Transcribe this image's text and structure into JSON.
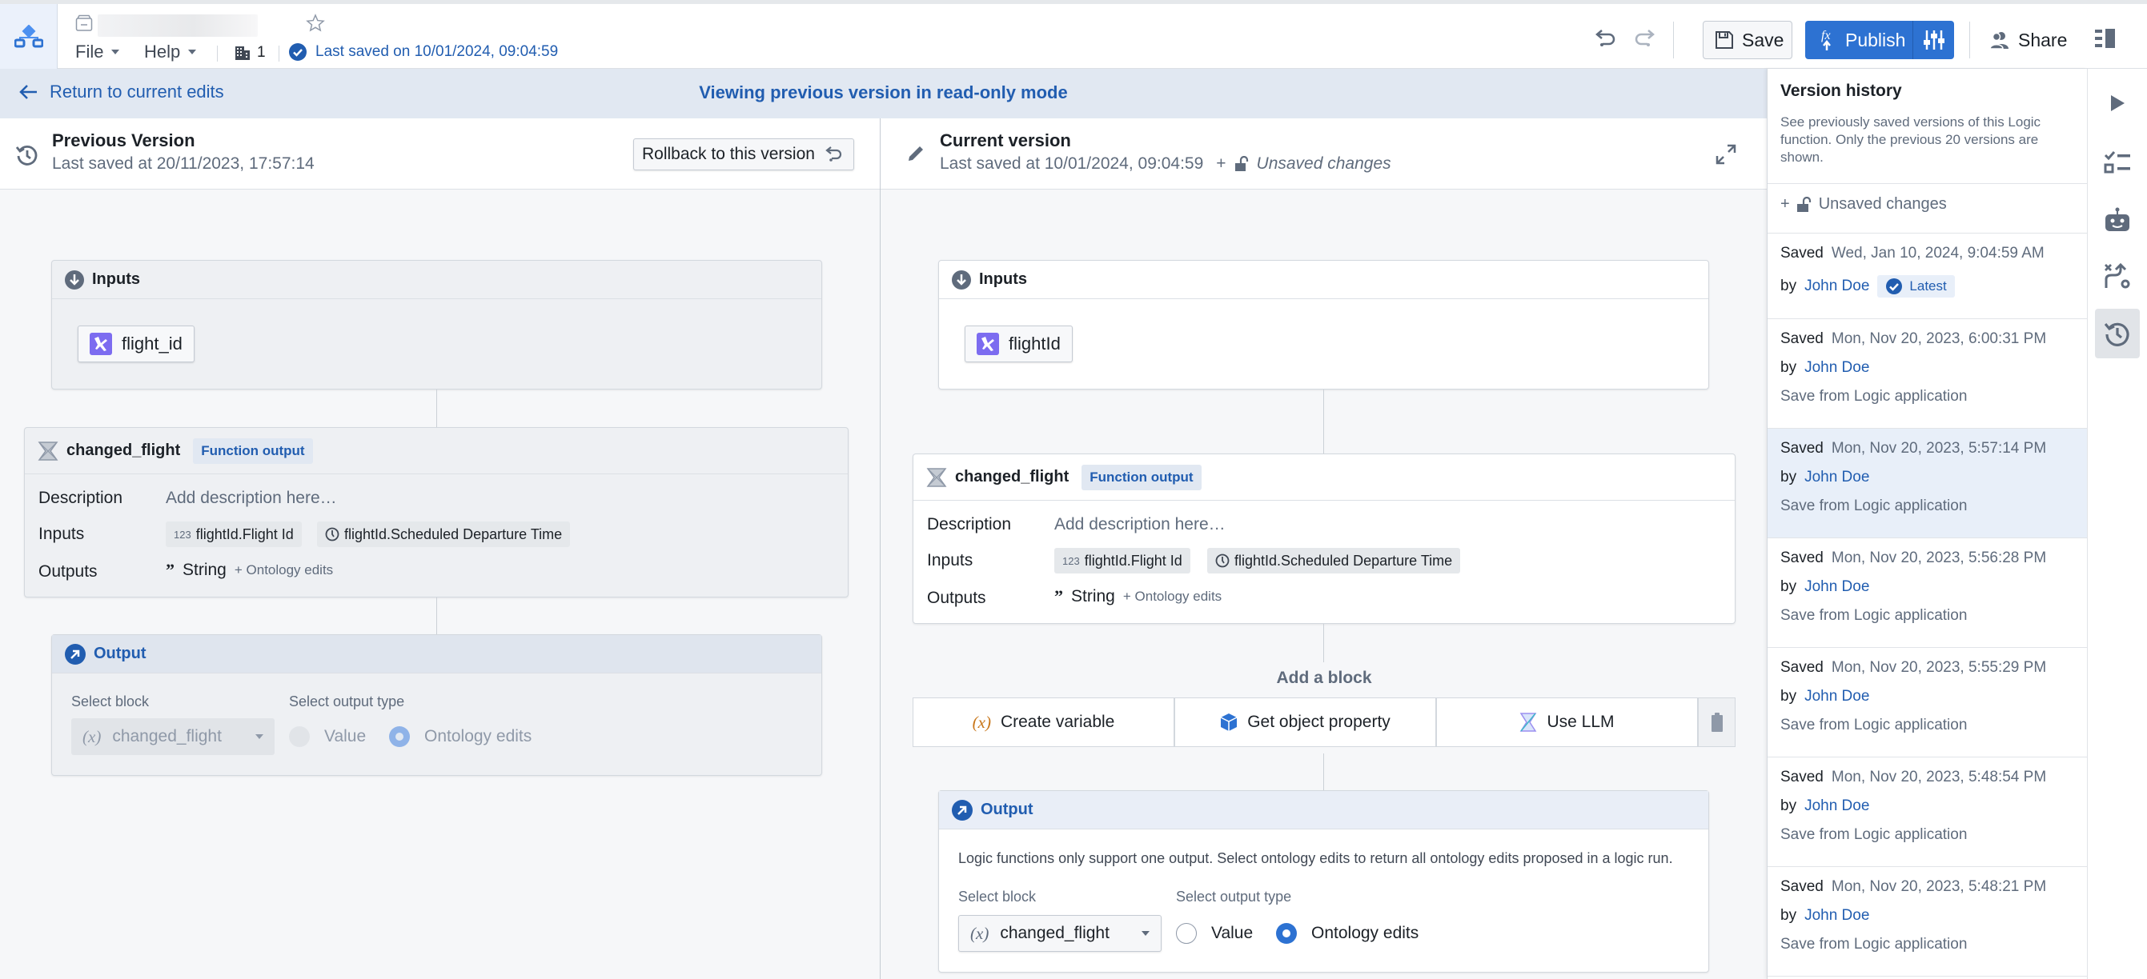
{
  "topbar": {
    "menus": [
      {
        "label": "File"
      },
      {
        "label": "Help"
      }
    ],
    "project_count": "1",
    "last_saved": "Last saved on 10/01/2024, 09:04:59",
    "save_label": "Save",
    "publish_label": "Publish",
    "share_label": "Share"
  },
  "banner": {
    "return_label": "Return to current edits",
    "mode_label": "Viewing previous version in read-only mode"
  },
  "previous": {
    "title": "Previous Version",
    "saved": "Last saved at 20/11/2023, 17:57:14",
    "rollback_label": "Rollback to this version",
    "inputs_title": "Inputs",
    "input_chip": "flight_id",
    "block": {
      "name": "changed_flight",
      "badge": "Function output",
      "description_label": "Description",
      "description_placeholder": "Add description here…",
      "inputs_label": "Inputs",
      "inputs": [
        {
          "icon": "123",
          "label": "flightId.Flight Id"
        },
        {
          "icon": "clock",
          "label": "flightId.Scheduled Departure Time"
        }
      ],
      "outputs_label": "Outputs",
      "output_type": "String",
      "output_extra": "+ Ontology edits"
    },
    "output": {
      "title": "Output",
      "select_block_label": "Select block",
      "select_block_value": "changed_flight",
      "output_type_label": "Select output type",
      "options": [
        {
          "label": "Value",
          "selected": false
        },
        {
          "label": "Ontology edits",
          "selected": true
        }
      ]
    }
  },
  "current": {
    "title": "Current version",
    "saved": "Last saved at 10/01/2024, 09:04:59",
    "plus": "+",
    "unsaved": "Unsaved changes",
    "inputs_title": "Inputs",
    "input_chip": "flightId",
    "block": {
      "name": "changed_flight",
      "badge": "Function output",
      "description_label": "Description",
      "description_placeholder": "Add description here…",
      "inputs_label": "Inputs",
      "inputs": [
        {
          "icon": "123",
          "label": "flightId.Flight Id"
        },
        {
          "icon": "clock",
          "label": "flightId.Scheduled Departure Time"
        }
      ],
      "outputs_label": "Outputs",
      "output_type": "String",
      "output_extra": "+ Ontology edits"
    },
    "add_block": {
      "title": "Add a block",
      "buttons": [
        {
          "label": "Create variable"
        },
        {
          "label": "Get object property"
        },
        {
          "label": "Use LLM"
        }
      ]
    },
    "output": {
      "title": "Output",
      "help": "Logic functions only support one output. Select ontology edits to return all ontology edits proposed in a logic run.",
      "select_block_label": "Select block",
      "select_block_value": "changed_flight",
      "output_type_label": "Select output type",
      "options": [
        {
          "label": "Value",
          "selected": false
        },
        {
          "label": "Ontology edits",
          "selected": true
        }
      ]
    }
  },
  "version_history": {
    "title": "Version history",
    "description": "See previously saved versions of this Logic function. Only the previous 20 versions are shown.",
    "unsaved_label": "Unsaved changes",
    "saved_word": "Saved",
    "by_word": "by",
    "latest_label": "Latest",
    "items": [
      {
        "date": "Wed, Jan 10, 2024, 9:04:59 AM",
        "author": "John Doe",
        "message": "",
        "latest": true,
        "selected": false
      },
      {
        "date": "Mon, Nov 20, 2023, 6:00:31 PM",
        "author": "John Doe",
        "message": "Save from Logic application",
        "latest": false,
        "selected": false
      },
      {
        "date": "Mon, Nov 20, 2023, 5:57:14 PM",
        "author": "John Doe",
        "message": "Save from Logic application",
        "latest": false,
        "selected": true
      },
      {
        "date": "Mon, Nov 20, 2023, 5:56:28 PM",
        "author": "John Doe",
        "message": "Save from Logic application",
        "latest": false,
        "selected": false
      },
      {
        "date": "Mon, Nov 20, 2023, 5:55:29 PM",
        "author": "John Doe",
        "message": "Save from Logic application",
        "latest": false,
        "selected": false
      },
      {
        "date": "Mon, Nov 20, 2023, 5:48:54 PM",
        "author": "John Doe",
        "message": "Save from Logic application",
        "latest": false,
        "selected": false
      },
      {
        "date": "Mon, Nov 20, 2023, 5:48:21 PM",
        "author": "John Doe",
        "message": "Save from Logic application",
        "latest": false,
        "selected": false
      }
    ]
  },
  "rail": {
    "items": [
      {
        "icon": "run-icon",
        "active": false
      },
      {
        "icon": "checklist-icon",
        "active": false
      },
      {
        "icon": "robot-icon",
        "active": false
      },
      {
        "icon": "branch-icon",
        "active": false
      },
      {
        "icon": "history-icon",
        "active": true
      }
    ]
  },
  "colors": {
    "accent": "#2d72d2",
    "link": "#215db0",
    "banner": "#e1e8f2",
    "plane_icon": "#7c6cf0"
  }
}
